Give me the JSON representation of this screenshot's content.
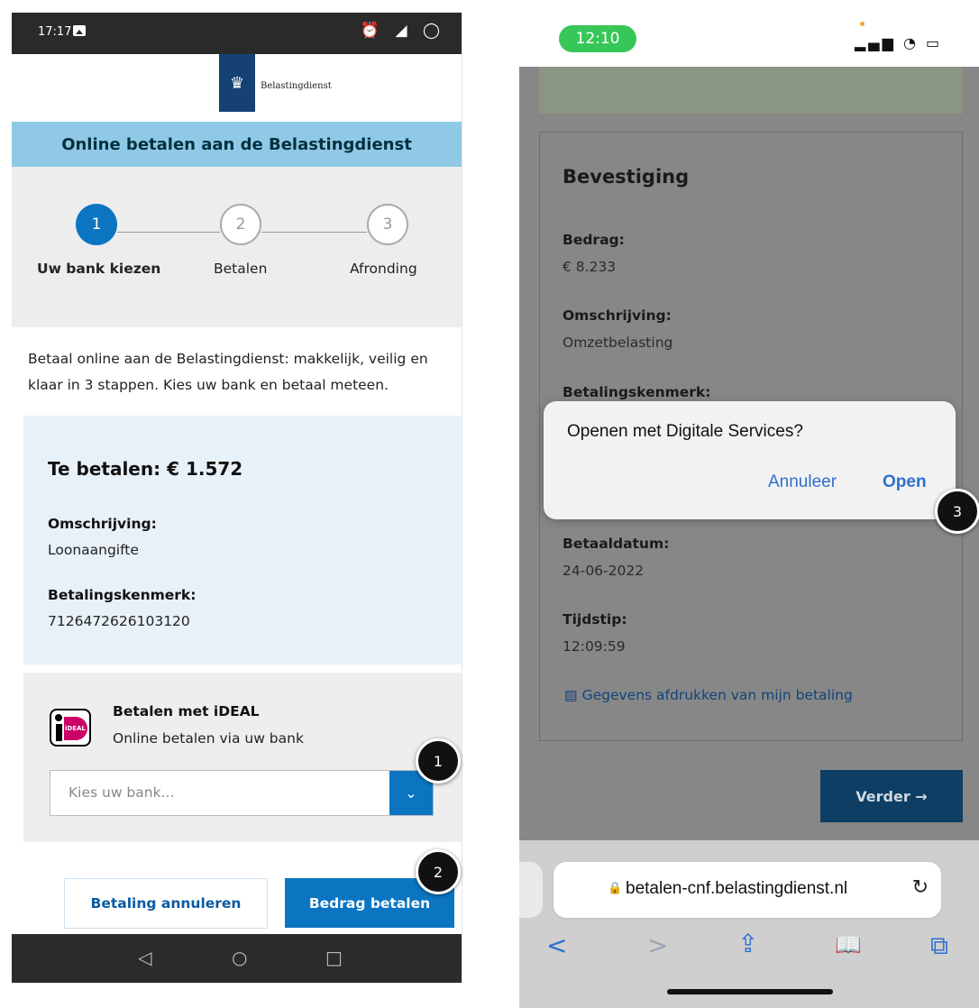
{
  "left_phone": {
    "status": {
      "time": "17:17",
      "icons": "⏰ ◢ ◯"
    },
    "logo": {
      "text": "Belastingdienst",
      "crest": "♛"
    },
    "header_title": "Online betalen aan de Belastingdienst",
    "steps": [
      {
        "number": "1",
        "label": "Uw bank kiezen",
        "active": true
      },
      {
        "number": "2",
        "label": "Betalen",
        "active": false
      },
      {
        "number": "3",
        "label": "Afronding",
        "active": false
      }
    ],
    "intro": "Betaal online aan de Belastingdienst: makkelijk, veilig en klaar in 3 stappen. Kies uw bank en betaal meteen.",
    "payment": {
      "amount": "Te betalen: € 1.572",
      "omschrijving_label": "Omschrijving:",
      "omschrijving_value": "Loonaangifte",
      "kenmerk_label": "Betalingskenmerk:",
      "kenmerk_value": "7126472626103120"
    },
    "ideal": {
      "logo_text": "iDEAL",
      "title": "Betalen met iDEAL",
      "subtitle": "Online betalen via uw bank",
      "select_placeholder": "Kies uw bank...",
      "select_arrow": "⌄"
    },
    "buttons": {
      "cancel": "Betaling annuleren",
      "pay": "Bedrag betalen"
    },
    "nav": {
      "back": "◁",
      "home": "○",
      "recents": "□"
    }
  },
  "right_phone": {
    "status": {
      "time": "12:10",
      "signal": "▂▄▆ ◔ ▭"
    },
    "confirmation_title": "Bevestiging",
    "fields": [
      {
        "label": "Bedrag:",
        "value": "€ 8.233"
      },
      {
        "label": "Omschrijving:",
        "value": "Omzetbelasting"
      },
      {
        "label": "Betalingskenmerk:",
        "value": ""
      },
      {
        "label": "Betaaldatum:",
        "value": "24-06-2022"
      },
      {
        "label": "Tijdstip:",
        "value": "12:09:59"
      }
    ],
    "print_link": "Gegevens afdrukken van mijn betaling",
    "verder_button": "Verder →",
    "dialog": {
      "question": "Openen met Digitale Services?",
      "cancel": "Annuleer",
      "open": "Open"
    },
    "url": "betalen-cnf.belastingdienst.nl",
    "toolbar": {
      "back": "<",
      "forward": ">",
      "share": "⇪",
      "bookmarks": "📖",
      "tabs": "⧉"
    }
  },
  "markers": [
    "1",
    "2",
    "3"
  ],
  "colors": {
    "primary_blue": "#0b75c2",
    "header_band": "#8fc9e6",
    "dark_navy": "#0e3e63",
    "ios_green": "#37c759",
    "ios_link": "#2f6fcf"
  }
}
